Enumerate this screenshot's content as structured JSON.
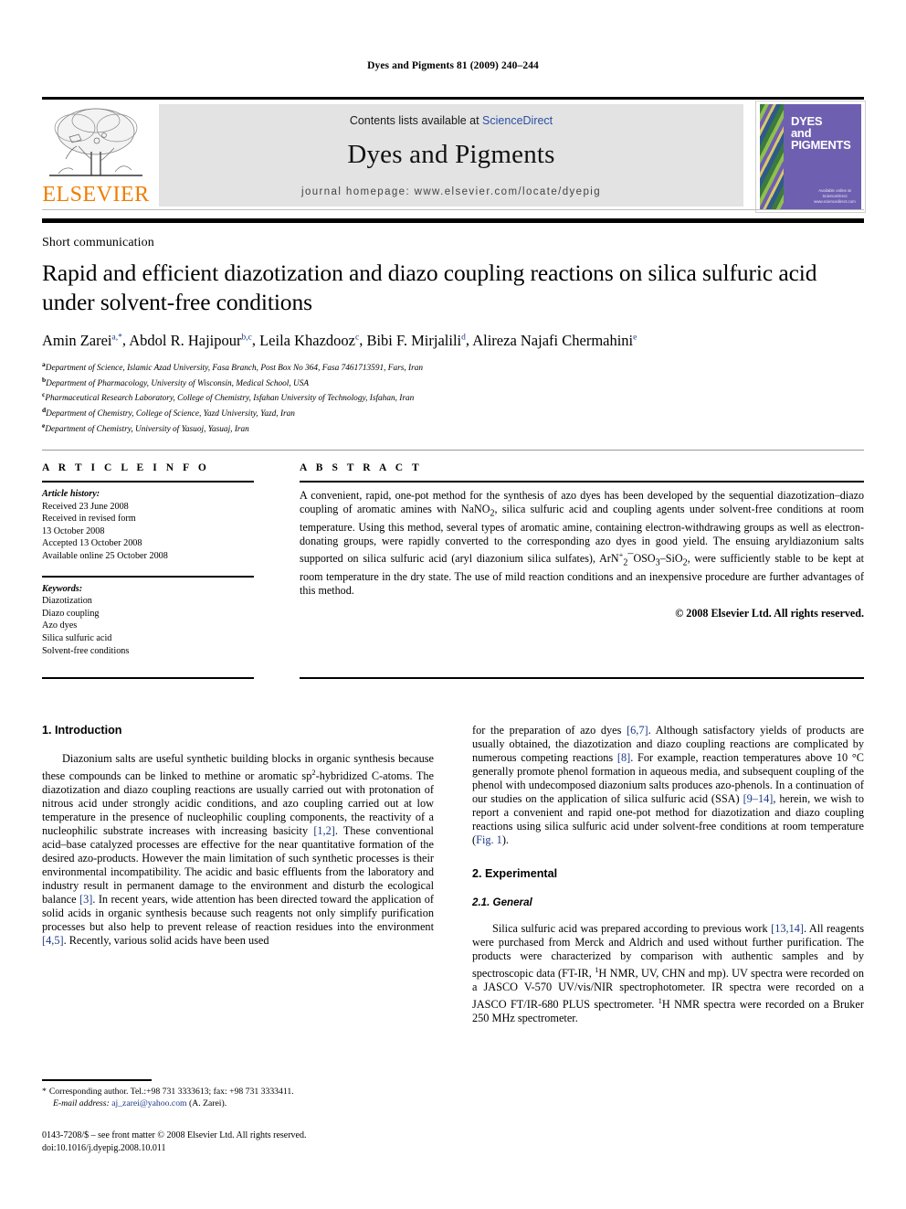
{
  "running_head": "Dyes and Pigments 81 (2009) 240–244",
  "masthead": {
    "contents_prefix": "Contents lists available at ",
    "sciencedirect": "ScienceDirect",
    "journal_name": "Dyes and Pigments",
    "homepage": "journal homepage: www.elsevier.com/locate/dyepig",
    "publisher_wordmark": "ELSEVIER",
    "publisher_color": "#F07D00",
    "link_color": "#2a4fa2",
    "cover": {
      "title_line1": "DYES",
      "title_line2": "and",
      "title_line3": "PIGMENTS",
      "foot_line1": "Available online at",
      "foot_line2": "ScienceDirect",
      "foot_line3": "www.sciencedirect.com",
      "background": "#6f5fb0"
    }
  },
  "article": {
    "type": "Short communication",
    "title": "Rapid and efficient diazotization and diazo coupling reactions on silica sulfuric acid under solvent-free conditions",
    "authors": [
      {
        "name": "Amin Zarei",
        "marks": "a,*"
      },
      {
        "name": "Abdol R. Hajipour",
        "marks": "b,c"
      },
      {
        "name": "Leila Khazdooz",
        "marks": "c"
      },
      {
        "name": "Bibi F. Mirjalili",
        "marks": "d"
      },
      {
        "name": "Alireza Najafi Chermahini",
        "marks": "e"
      }
    ],
    "affiliations": [
      {
        "mark": "a",
        "text": "Department of Science, Islamic Azad University, Fasa Branch, Post Box No 364, Fasa 7461713591, Fars, Iran"
      },
      {
        "mark": "b",
        "text": "Department of Pharmacology, University of Wisconsin, Medical School, USA"
      },
      {
        "mark": "c",
        "text": "Pharmaceutical Research Laboratory, College of Chemistry, Isfahan University of Technology, Isfahan, Iran"
      },
      {
        "mark": "d",
        "text": "Department of Chemistry, College of Science, Yazd University, Yazd, Iran"
      },
      {
        "mark": "e",
        "text": "Department of Chemistry, University of Yasuoj, Yasuaj, Iran"
      }
    ]
  },
  "article_info": {
    "heading": "A R T I C L E  I N F O",
    "history_label": "Article history:",
    "history": [
      "Received 23 June 2008",
      "Received in revised form",
      "13 October 2008",
      "Accepted 13 October 2008",
      "Available online 25 October 2008"
    ],
    "keywords_label": "Keywords:",
    "keywords": [
      "Diazotization",
      "Diazo coupling",
      "Azo dyes",
      "Silica sulfuric acid",
      "Solvent-free conditions"
    ]
  },
  "abstract": {
    "heading": "A B S T R A C T",
    "part1": "A convenient, rapid, one-pot method for the synthesis of azo dyes has been developed by the sequential diazotization–diazo coupling of aromatic amines with NaNO",
    "sub1": "2",
    "part2": ", silica sulfuric acid and coupling agents under solvent-free conditions at room temperature. Using this method, several types of aromatic amine, containing electron-withdrawing groups as well as electron-donating groups, were rapidly converted to the corresponding azo dyes in good yield. The ensuing aryldiazonium salts supported on silica sulfuric acid (aryl diazonium silica sulfates), ArN",
    "formula_sup": "+",
    "formula_sub": "2",
    "part3": "¯OSO",
    "sub3": "3",
    "part4": "–SiO",
    "sub4": "2",
    "part5": ", were sufficiently stable to be kept at room temperature in the dry state. The use of mild reaction conditions and an inexpensive procedure are further advantages of this method.",
    "copyright": "© 2008 Elsevier Ltd. All rights reserved."
  },
  "body": {
    "left": {
      "h_intro": "1.  Introduction",
      "p1_a": "Diazonium salts are useful synthetic building blocks in organic synthesis because these compounds can be linked to methine or aromatic sp",
      "p1_sup": "2",
      "p1_b": "-hybridized C-atoms. The diazotization and diazo coupling reactions are usually carried out with protonation of nitrous acid under strongly acidic conditions, and azo coupling carried out at low temperature in the presence of nucleophilic coupling components, the reactivity of a nucleophilic substrate increases with increasing basicity ",
      "ref12": "[1,2]",
      "p1_c": ". These conventional acid–base catalyzed processes are effective for the near quantitative formation of the desired azo-products. However the main limitation of such synthetic processes is their environmental incompatibility. The acidic and basic effluents from the laboratory and industry result in permanent damage to the environment and disturb the ecological balance ",
      "ref3": "[3]",
      "p1_d": ". In recent years, wide attention has been directed toward the application of solid acids in organic synthesis because such reagents not only simplify purification processes but also help to prevent release of reaction residues into the environment ",
      "ref45": "[4,5]",
      "p1_e": ". Recently, various solid acids have been used"
    },
    "right": {
      "p2_a": "for the preparation of azo dyes ",
      "ref67": "[6,7]",
      "p2_b": ". Although satisfactory yields of products are usually obtained, the diazotization and diazo coupling reactions are complicated by numerous competing reactions ",
      "ref8": "[8]",
      "p2_c": ". For example, reaction temperatures above 10 °C generally promote phenol formation in aqueous media, and subsequent coupling of the phenol with undecomposed diazonium salts produces azo-phenols. In a continuation of our studies on the application of silica sulfuric acid (SSA) ",
      "ref914": "[9–14]",
      "p2_d": ", herein, we wish to report a convenient and rapid one-pot method for diazotization and diazo coupling reactions using silica sulfuric acid under solvent-free conditions at room temperature (",
      "figref": "Fig. 1",
      "p2_e": ").",
      "h_experimental": "2.  Experimental",
      "h_general": "2.1.  General",
      "p3_a": "Silica sulfuric acid was prepared according to previous work ",
      "ref1314": "[13,14]",
      "p3_b": ". All reagents were purchased from Merck and Aldrich and used without further purification. The products were characterized by comparison with authentic samples and by spectroscopic data (FT-IR, ",
      "sup1a": "1",
      "p3_c": "H NMR, UV, CHN and mp). UV spectra were recorded on a JASCO V-570 UV/vis/NIR spectrophotometer. IR spectra were recorded on a JASCO FT/IR-680 PLUS spectrometer. ",
      "sup1b": "1",
      "p3_d": "H NMR spectra were recorded on a Bruker 250 MHz spectrometer."
    }
  },
  "footnote": {
    "star": "*",
    "corresponding": "Corresponding author. Tel.:+98 731 3333613; fax: +98 731 3333411.",
    "email_label": "E-mail address:",
    "email": "aj_zarei@yahoo.com",
    "email_owner": "(A. Zarei)."
  },
  "imprint": {
    "line1": "0143-7208/$ – see front matter © 2008 Elsevier Ltd. All rights reserved.",
    "line2": "doi:10.1016/j.dyepig.2008.10.011"
  }
}
